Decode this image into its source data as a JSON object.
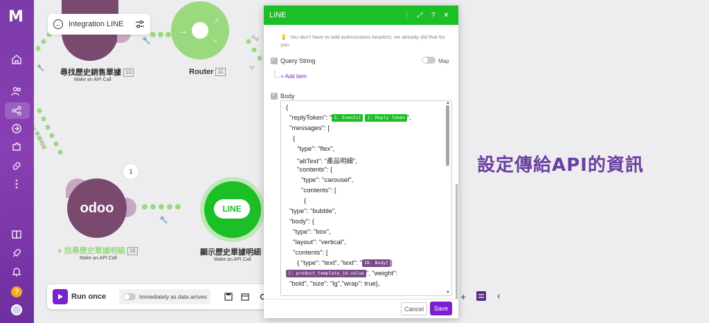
{
  "scenario": {
    "name": "Integration LINE"
  },
  "nodes": [
    {
      "label": "尋找歷史銷售單據",
      "id": "10",
      "sub": "Make an API Call"
    },
    {
      "label": "Router",
      "id": "11"
    },
    {
      "label": "找尋歷史單據明細",
      "id": "16",
      "sub": "Make an API Call"
    },
    {
      "label": "顯示歷史單據明細",
      "sub": "Make an API Call"
    }
  ],
  "canvas": {
    "odoo_logo": "odoo",
    "line_logo": "LINE",
    "badge_count": "1",
    "route_label_1": "1st",
    "route_label_1_text": "單據明細",
    "route_label_2": "2nd"
  },
  "toolbar": {
    "run_label": "Run once",
    "immediately_label": "Immediately as data arrives"
  },
  "annotation": "設定傳給API的資訊",
  "modal": {
    "title": "LINE",
    "hint": "You don't have to add authorization headers; we already did that for you.",
    "query_string_label": "Query String",
    "map_label": "Map",
    "add_item_label": "Add item",
    "body_label": "Body",
    "code": {
      "l1": "{",
      "l2_pre": "\"replyToken\": \"",
      "l2_pill1": "3. Events[",
      "l2_pill2": "]: Reply Token",
      "l2_post": "\",",
      "l3": "\"messages\": [",
      "l4": "{",
      "l5": "\"type\": \"flex\",",
      "l6": "\"altText\": \"產品明細\",",
      "l7": "\"contents\": {",
      "l8": "\"type\": \"carousel\",",
      "l9": "\"contents\": [",
      "l10": "{",
      "l11": "\"type\": \"bubble\",",
      "l12": "\"body\": {",
      "l13": "\"type\": \"box\",",
      "l14": "\"layout\": \"vertical\",",
      "l15": "\"contents\": [",
      "l16_pre": "{ \"type\": \"text\", \"text\": \"",
      "l16_pill": "18. Body[",
      "l16_post": "]",
      "l17_pill": "]: product_template_id.value",
      "l17_post": "\", \"weight\":",
      "l18": "\"bold\", \"size\": \"lg\",\"wrap\": true},"
    },
    "cancel_label": "Cancel",
    "save_label": "Save"
  },
  "colors": {
    "accent": "#7a1fd1",
    "line_green": "#1cbf26",
    "odoo_purple": "#7a4a6e",
    "router_green": "#9ad97e"
  }
}
